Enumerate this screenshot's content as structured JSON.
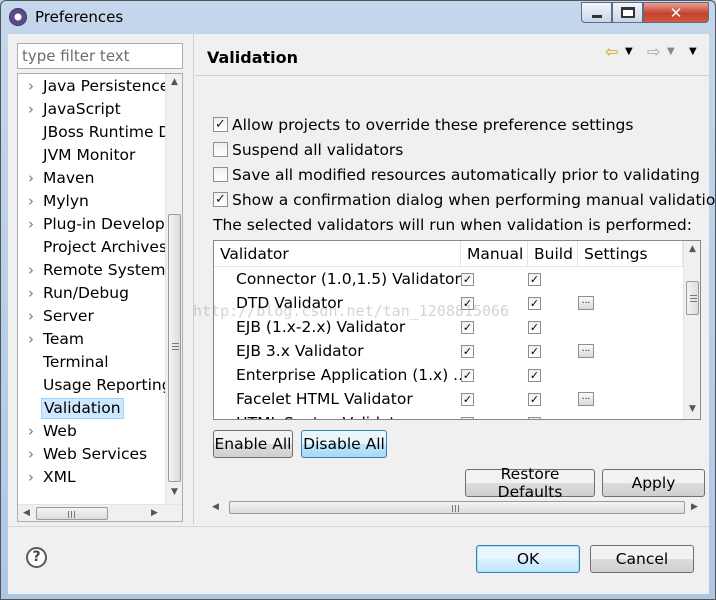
{
  "window": {
    "title": "Preferences"
  },
  "filter": {
    "placeholder": "type filter text"
  },
  "tree": {
    "items": [
      {
        "label": "Java Persistence",
        "expandable": true
      },
      {
        "label": "JavaScript",
        "expandable": true
      },
      {
        "label": "JBoss Runtime De",
        "expandable": false
      },
      {
        "label": "JVM Monitor",
        "expandable": false
      },
      {
        "label": "Maven",
        "expandable": true
      },
      {
        "label": "Mylyn",
        "expandable": true
      },
      {
        "label": "Plug-in Developr",
        "expandable": true
      },
      {
        "label": "Project Archives",
        "expandable": false
      },
      {
        "label": "Remote Systems",
        "expandable": true
      },
      {
        "label": "Run/Debug",
        "expandable": true
      },
      {
        "label": "Server",
        "expandable": true
      },
      {
        "label": "Team",
        "expandable": true
      },
      {
        "label": "Terminal",
        "expandable": false
      },
      {
        "label": "Usage Reporting",
        "expandable": false
      },
      {
        "label": "Validation",
        "expandable": false,
        "selected": true
      },
      {
        "label": "Web",
        "expandable": true
      },
      {
        "label": "Web Services",
        "expandable": true
      },
      {
        "label": "XML",
        "expandable": true
      }
    ]
  },
  "page": {
    "title": "Validation",
    "options": [
      {
        "label": "Allow projects to override these preference settings",
        "checked": true
      },
      {
        "label": "Suspend all validators",
        "checked": false
      },
      {
        "label": "Save all modified resources automatically prior to validating",
        "checked": false
      },
      {
        "label": "Show a confirmation dialog when performing manual validations",
        "checked": true
      }
    ],
    "info": "The selected validators will run when validation is performed:",
    "table": {
      "columns": [
        "Validator",
        "Manual",
        "Build",
        "Settings"
      ],
      "rows": [
        {
          "name": "Connector (1.0,1.5) Validator",
          "manual": true,
          "build": true,
          "settings": false
        },
        {
          "name": "DTD Validator",
          "manual": true,
          "build": true,
          "settings": true
        },
        {
          "name": "EJB (1.x-2.x) Validator",
          "manual": true,
          "build": true,
          "settings": false
        },
        {
          "name": "EJB 3.x Validator",
          "manual": true,
          "build": true,
          "settings": true
        },
        {
          "name": "Enterprise Application (1.x) ...",
          "manual": true,
          "build": true,
          "settings": false
        },
        {
          "name": "Facelet HTML Validator",
          "manual": true,
          "build": true,
          "settings": true
        },
        {
          "name": "HTML Syntax Validator",
          "manual": true,
          "build": true,
          "settings": false
        }
      ]
    },
    "enable_all": "Enable All",
    "disable_all": "Disable All",
    "restore_defaults": "Restore Defaults",
    "apply": "Apply"
  },
  "dialog": {
    "ok": "OK",
    "cancel": "Cancel"
  },
  "watermark": "http://blog.csdn.net/tan_1208815066"
}
